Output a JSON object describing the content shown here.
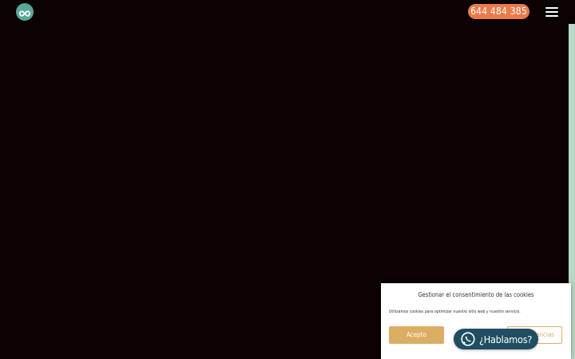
{
  "header": {
    "logo_icon": "infinity-icon",
    "phone_label": "644 484 385",
    "menu_icon": "hamburger-menu-icon"
  },
  "cookie_banner": {
    "title": "Gestionar el consentimiento de las cookies",
    "text": "Utilizamos cookies para optimizar nuestro sitio web y nuestro servicio.",
    "accept_label": "Acepto",
    "preferences_label": "Preferencias"
  },
  "whatsapp_button": {
    "label": "¿Hablamos?",
    "icon": "whatsapp-icon"
  },
  "colors": {
    "background": "#0a0203",
    "accent_phone": "#ec7a4a",
    "accent_logo": "#5aa79a",
    "accept_button": "#dcae63",
    "whatsapp": "#1f4e63",
    "scrollbar": "#b9d9c4"
  }
}
